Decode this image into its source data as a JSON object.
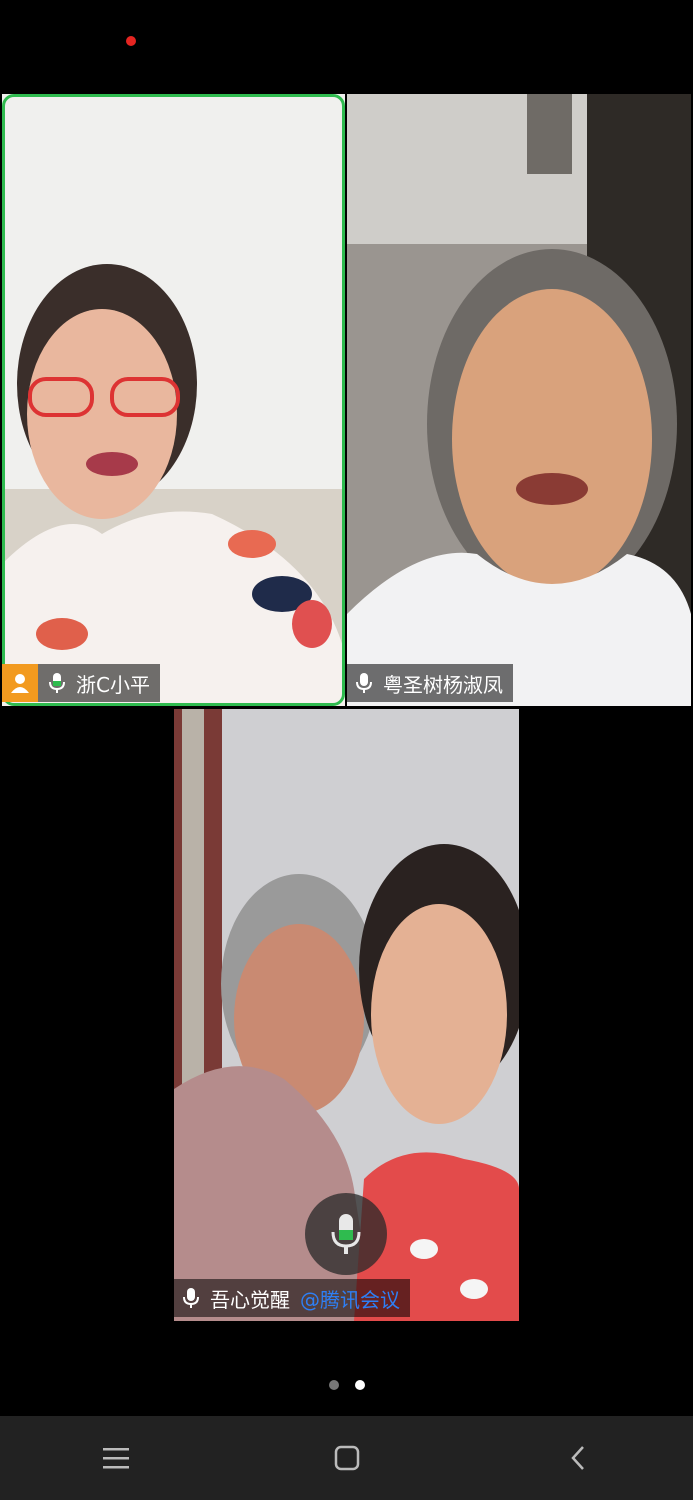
{
  "participants": [
    {
      "name": "浙C小平",
      "is_host": true,
      "speaking": true
    },
    {
      "name": "粤圣树杨淑凤",
      "is_host": false,
      "speaking": false
    },
    {
      "name": "吾心觉醒",
      "watermark": "@腾讯会议",
      "is_host": false,
      "speaking": false
    }
  ],
  "pager": {
    "pages": 2,
    "active_index": 1
  },
  "icons": {
    "mic": "mic-icon",
    "host": "host-icon",
    "nav_menu": "menu-icon",
    "nav_home": "home-icon",
    "nav_back": "back-icon"
  },
  "colors": {
    "active_speaker_border": "#2fbb4f",
    "host_badge": "#f29a1f",
    "recording_dot": "#e52521",
    "watermark": "#2e7ff5"
  }
}
